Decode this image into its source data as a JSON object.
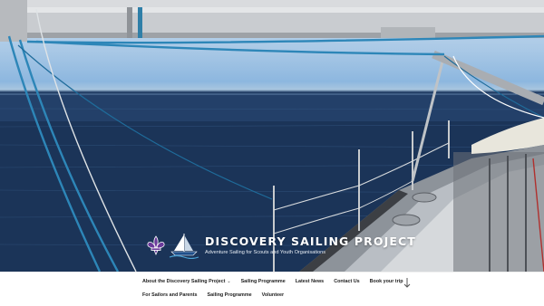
{
  "site": {
    "title": "DISCOVERY SAILING PROJECT",
    "tagline": "Adventure Sailing for Scouts and Youth Organisations",
    "logo_icon": "fleur-de-lis-icon",
    "logo_boat_icon": "sailboat-icon"
  },
  "nav": {
    "primary": [
      {
        "label": "About the Discovery Sailing Project",
        "has_submenu": true
      },
      {
        "label": "Sailing Programme"
      },
      {
        "label": "Latest News"
      },
      {
        "label": "Contact Us"
      },
      {
        "label": "Book your trip"
      }
    ],
    "secondary": [
      {
        "label": "For Sailors and Parents"
      },
      {
        "label": "Sailing Programme"
      },
      {
        "label": "Volunteer"
      }
    ],
    "submenu_icon": "chevron-down-icon",
    "scroll_icon": "arrow-down-icon"
  },
  "colors": {
    "logo_purple": "#6a3a9a",
    "nav_text": "#222222",
    "title_text": "#ffffff"
  }
}
